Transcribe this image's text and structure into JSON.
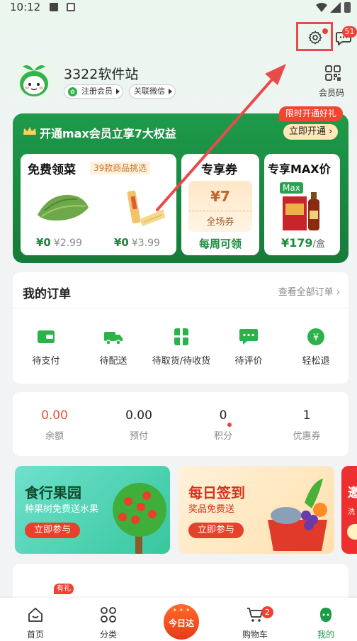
{
  "status_bar": {
    "time": "10:12"
  },
  "header": {
    "message_badge": "51"
  },
  "profile": {
    "name": "3322软件站",
    "register_label": "注册会员",
    "wechat_label": "关联微信",
    "member_code_label": "会员码"
  },
  "vip": {
    "title": "开通max会员立享7大权益",
    "limited_tag": "限时开通好礼",
    "open_button": "立即开通",
    "free_veg": {
      "title": "免费领菜",
      "tag": "39款商品挑选",
      "items": [
        {
          "price": "¥0",
          "old_price": "¥2.99"
        },
        {
          "price": "¥0",
          "old_price": "¥3.99"
        }
      ]
    },
    "coupon": {
      "title": "专享券",
      "amount": "¥7",
      "label": "全场券",
      "footer": "每周可领"
    },
    "max_price": {
      "title": "专享MAX价",
      "tag": "Max",
      "price": "¥179",
      "unit": "/盒"
    }
  },
  "orders": {
    "title": "我的订单",
    "view_all": "查看全部订单",
    "items": [
      {
        "label": "待支付",
        "icon": "wallet-icon"
      },
      {
        "label": "待配送",
        "icon": "delivery-truck-icon"
      },
      {
        "label": "待取货/待收货",
        "icon": "package-icon"
      },
      {
        "label": "待评价",
        "icon": "comment-icon"
      },
      {
        "label": "轻松退",
        "icon": "refund-icon"
      }
    ]
  },
  "wallet": {
    "items": [
      {
        "value": "0.00",
        "label": "余额"
      },
      {
        "value": "0.00",
        "label": "预付"
      },
      {
        "value": "0",
        "label": "积分"
      },
      {
        "value": "1",
        "label": "优惠券"
      }
    ]
  },
  "banners": [
    {
      "title": "食行果园",
      "subtitle": "种果树免费送水果",
      "button": "立即参与"
    },
    {
      "title": "每日签到",
      "subtitle": "奖品免费送",
      "button": "立即参与"
    },
    {
      "title": "邀",
      "subtitle": "洗"
    }
  ],
  "tools": {
    "tag": "有礼"
  },
  "tabbar": {
    "items": [
      {
        "label": "首页"
      },
      {
        "label": "分类"
      },
      {
        "label": "今日达"
      },
      {
        "label": "购物车"
      },
      {
        "label": "我的"
      }
    ],
    "cart_badge": "2",
    "active_color": "#1c9a45"
  },
  "colors": {
    "brand_green": "#1c8a3f",
    "alert_red": "#f04134",
    "annotation_red": "#e84b4b"
  }
}
